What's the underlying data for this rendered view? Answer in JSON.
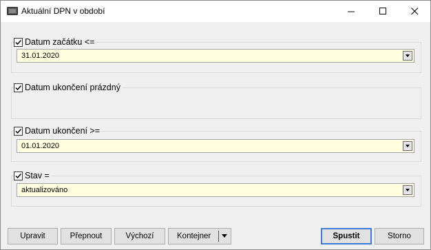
{
  "window": {
    "title": "Aktuální DPN v období"
  },
  "filters": [
    {
      "label": "Datum začátku <=",
      "checked": true,
      "value": "31.01.2020"
    },
    {
      "label": "Datum ukončení  prázdný",
      "checked": true
    },
    {
      "label": "Datum ukončení >=",
      "checked": true,
      "value": "01.01.2020"
    },
    {
      "label": "Stav =",
      "checked": true,
      "value": "aktualizováno"
    }
  ],
  "buttons": {
    "edit": "Upravit",
    "switch": "Přepnout",
    "default": "Výchozí",
    "container": "Kontejner",
    "run": "Spustit",
    "cancel": "Storno"
  }
}
